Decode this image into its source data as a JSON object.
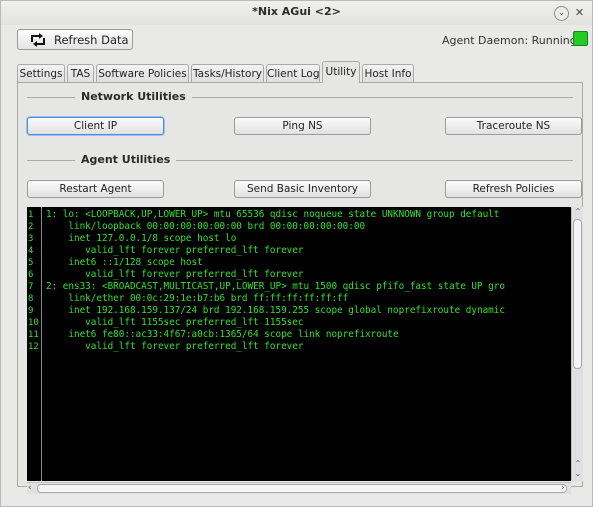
{
  "window": {
    "title": "*Nix AGui <2>"
  },
  "toolbar": {
    "refresh_label": "Refresh Data",
    "daemon_status": "Agent Daemon: Running",
    "daemon_led_color": "#22cc22"
  },
  "tabs": [
    {
      "label": "Settings"
    },
    {
      "label": "TAS"
    },
    {
      "label": "Software Policies"
    },
    {
      "label": "Tasks/History"
    },
    {
      "label": "Client Log"
    },
    {
      "label": "Utility"
    },
    {
      "label": "Host Info"
    }
  ],
  "active_tab": "Utility",
  "network_utilities": {
    "title": "Network Utilities",
    "buttons": [
      {
        "label": "Client IP"
      },
      {
        "label": "Ping NS"
      },
      {
        "label": "Traceroute NS"
      }
    ]
  },
  "agent_utilities": {
    "title": "Agent Utilities",
    "buttons": [
      {
        "label": "Restart Agent"
      },
      {
        "label": "Send Basic Inventory"
      },
      {
        "label": "Refresh Policies"
      }
    ]
  },
  "output": {
    "line_numbers": [
      "1",
      "2",
      "3",
      "4",
      "5",
      "6",
      "7",
      "8",
      "9",
      "10",
      "11",
      "12"
    ],
    "lines": [
      "1: lo: <LOOPBACK,UP,LOWER_UP> mtu 65536 qdisc noqueue state UNKNOWN group default",
      "    link/loopback 00:00:00:00:00:00 brd 00:00:00:00:00:00",
      "    inet 127.0.0.1/8 scope host lo",
      "       valid_lft forever preferred_lft forever",
      "    inet6 ::1/128 scope host",
      "       valid_lft forever preferred_lft forever",
      "2: ens33: <BROADCAST,MULTICAST,UP,LOWER_UP> mtu 1500 qdisc pfifo_fast state UP gro",
      "    link/ether 00:0c:29:1e:b7:b6 brd ff:ff:ff:ff:ff:ff",
      "    inet 192.168.159.137/24 brd 192.168.159.255 scope global noprefixroute dynamic",
      "       valid_lft 1155sec preferred_lft 1155sec",
      "    inet6 fe80::ac33:4f67:a0cb:1365/64 scope link noprefixroute",
      "       valid_lft forever preferred_lft forever"
    ],
    "text_color": "#31e231",
    "background": "#000000"
  }
}
